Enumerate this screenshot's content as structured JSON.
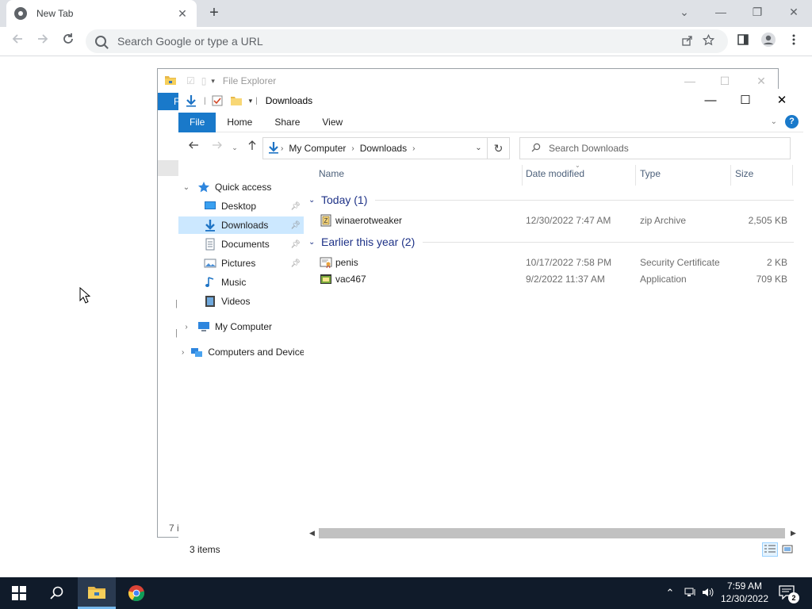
{
  "chrome": {
    "tab_title": "New Tab",
    "tab_close": "✕",
    "new_tab": "+",
    "omnibox_placeholder": "Search Google or type a URL",
    "controls": {
      "tabsearch": "⌄",
      "minimize": "—",
      "restore": "❐",
      "close": "✕"
    }
  },
  "explorer_back": {
    "title": "File Explorer",
    "file_tab": "F",
    "status_fragment": "7 i",
    "side_fragments": [
      "|",
      "|"
    ]
  },
  "explorer": {
    "title": "Downloads",
    "ribbon": {
      "file": "File",
      "home": "Home",
      "share": "Share",
      "view": "View",
      "help": "?"
    },
    "breadcrumb": [
      "My Computer",
      "Downloads"
    ],
    "search_placeholder": "Search Downloads",
    "nav": {
      "quick_access": "Quick access",
      "items": [
        {
          "label": "Desktop",
          "icon": "desktop-icon",
          "pinned": true
        },
        {
          "label": "Downloads",
          "icon": "downloads-icon",
          "pinned": true,
          "selected": true
        },
        {
          "label": "Documents",
          "icon": "documents-icon",
          "pinned": true
        },
        {
          "label": "Pictures",
          "icon": "pictures-icon",
          "pinned": true
        },
        {
          "label": "Music",
          "icon": "music-icon",
          "pinned": false
        },
        {
          "label": "Videos",
          "icon": "videos-icon",
          "pinned": false
        }
      ],
      "my_computer": "My Computer",
      "network": "Computers and Devices"
    },
    "columns": {
      "name": "Name",
      "date": "Date modified",
      "type": "Type",
      "size": "Size"
    },
    "groups": [
      {
        "label": "Today (1)",
        "files": [
          {
            "name": "winaerotweaker",
            "date": "12/30/2022 7:47 AM",
            "type": "zip Archive",
            "size": "2,505 KB",
            "icon": "zip-icon"
          }
        ]
      },
      {
        "label": "Earlier this year (2)",
        "files": [
          {
            "name": "penis",
            "date": "10/17/2022 7:58 PM",
            "type": "Security Certificate",
            "size": "2 KB",
            "icon": "certificate-icon"
          },
          {
            "name": "vac467",
            "date": "9/2/2022 11:37 AM",
            "type": "Application",
            "size": "709 KB",
            "icon": "application-icon"
          }
        ]
      }
    ],
    "status": "3 items"
  },
  "taskbar": {
    "time": "7:59 AM",
    "date": "12/30/2022",
    "notification_count": "2"
  },
  "colors": {
    "accent": "#1979ca",
    "selection": "#cce8ff",
    "group_header": "#1e3287",
    "taskbar": "#101b2a"
  }
}
